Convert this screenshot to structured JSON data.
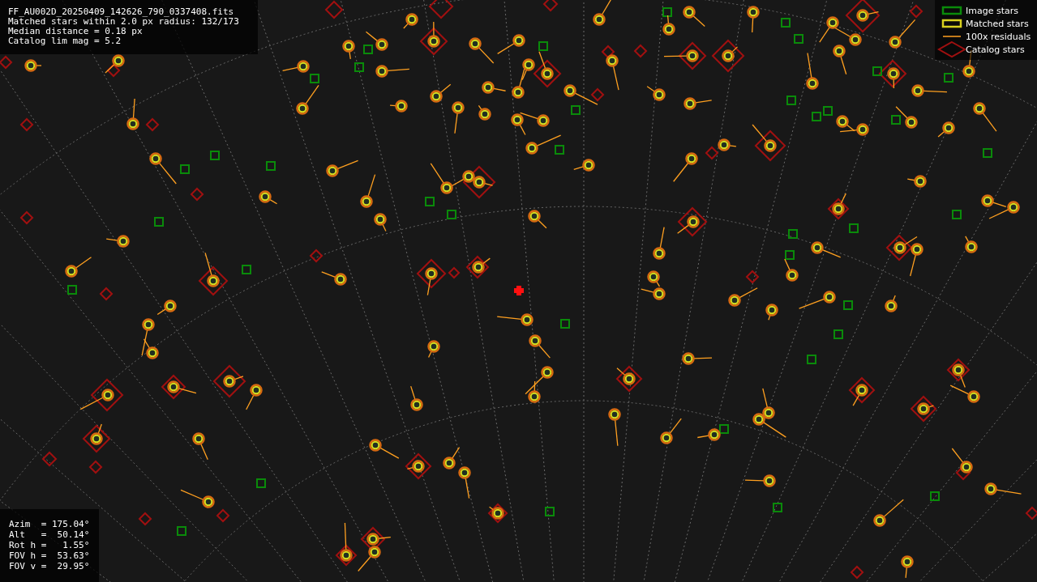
{
  "info": {
    "lines": [
      "FF_AU002D_20250409_142626_790_0337408.fits",
      "Matched stars within 2.0 px radius: 132/173",
      "Median distance = 0.18 px",
      "Catalog lim mag = 5.2"
    ]
  },
  "legend": [
    {
      "kind": "image",
      "label": "Image stars"
    },
    {
      "kind": "matched",
      "label": "Matched stars"
    },
    {
      "kind": "residual",
      "label": "100x residuals"
    },
    {
      "kind": "catalog",
      "label": "Catalog stars"
    }
  ],
  "pointing": {
    "lines": [
      "Azim  = 175.04°",
      "Alt   =  50.14°",
      "Rot h =   1.55°",
      "FOV h =  53.63°",
      "FOV v =  29.95°"
    ]
  }
}
